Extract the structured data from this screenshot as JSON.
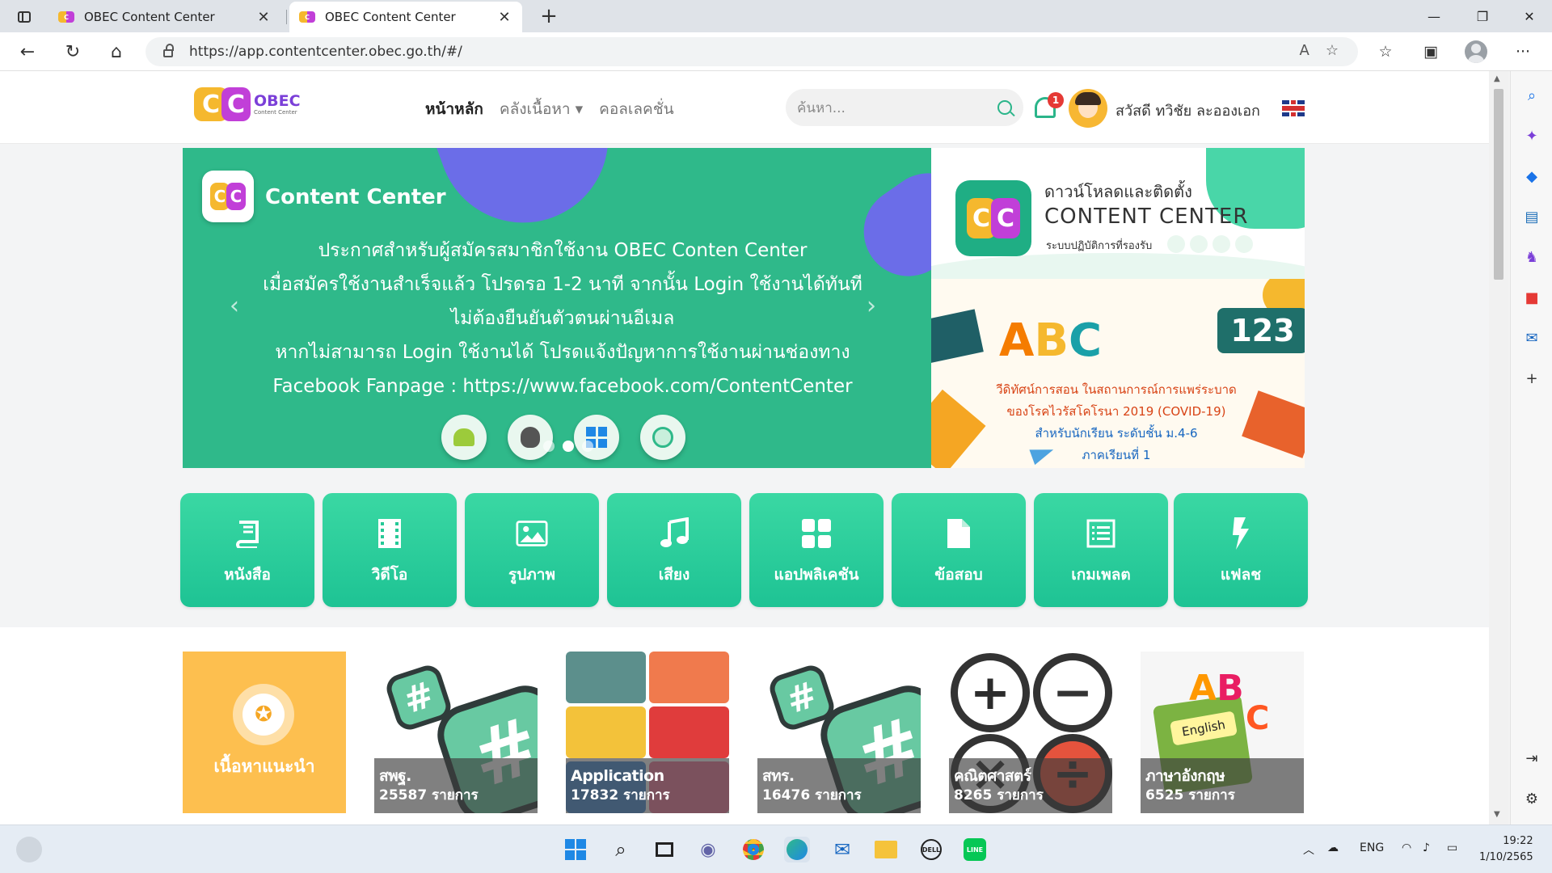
{
  "browser": {
    "tabs": [
      {
        "title": "OBEC Content Center",
        "active": false
      },
      {
        "title": "OBEC Content Center",
        "active": true
      }
    ],
    "url": "https://app.contentcenter.obec.go.th/#/"
  },
  "site": {
    "logo_text": "OBEC",
    "logo_sub": "Content Center",
    "logo_letters": "CC",
    "nav": [
      "หน้าหลัก",
      "คลังเนื้อหา",
      "คอลเลคชั่น"
    ],
    "search_placeholder": "ค้นหา...",
    "notification_count": "1",
    "user_greeting": "สวัสดี ทวิชัย ละอองเอก"
  },
  "banner": {
    "title": "Content Center",
    "lines": [
      "ประกาศสำหรับผู้สมัครสมาชิกใช้งาน OBEC Conten Center",
      "เมื่อสมัครใช้งานสำเร็จแล้ว โปรดรอ 1-2 นาที จากนั้น Login ใช้งานได้ทันที",
      "ไม่ต้องยืนยันตัวตนผ่านอีเมล",
      "หากไม่สามารถ Login ใช้งานได้ โปรดแจ้งปัญหาการใช้งานผ่านช่องทาง",
      "Facebook Fanpage : https://www.facebook.com/ContentCenter"
    ]
  },
  "promo_download": {
    "title": "ดาวน์โหลดและติดตั้ง",
    "subtitle": "CONTENT CENTER",
    "os_label": "ระบบปฏิบัติการที่รองรับ"
  },
  "promo_covid": {
    "letters": "ABC",
    "numbers": "123",
    "line1": "วีดิทัศน์การสอน ในสถานการณ์การแพร่ระบาด",
    "line2": "ของโรคไวรัสโคโรนา 2019 (COVID-19)",
    "line3": "สำหรับนักเรียน ระดับชั้น ม.4-6",
    "line4": "ภาคเรียนที่ 1"
  },
  "categories": [
    "หนังสือ",
    "วิดีโอ",
    "รูปภาพ",
    "เสียง",
    "แอปพลิเคชัน",
    "ข้อสอบ",
    "เกมเพลต",
    "แฟลช"
  ],
  "collections": [
    {
      "label": "เนื้อหาแนะนำ"
    },
    {
      "name": "สพฐ.",
      "count": "25587 รายการ"
    },
    {
      "name": "Application",
      "count": "17832 รายการ"
    },
    {
      "name": "สทร.",
      "count": "16476 รายการ"
    },
    {
      "name": "คณิตศาสตร์",
      "count": "8265 รายการ"
    },
    {
      "name": "ภาษาอังกฤษ",
      "count": "6525 รายการ",
      "art_text": "English"
    }
  ],
  "taskbar": {
    "lang": "ENG",
    "time": "19:22",
    "date": "1/10/2565"
  },
  "colors": {
    "brand_green": "#2fb98a",
    "category_green": "#26c997",
    "accent_purple": "#6b6de8",
    "logo_yellow": "#f5b82e",
    "logo_magenta": "#c13fd8"
  }
}
